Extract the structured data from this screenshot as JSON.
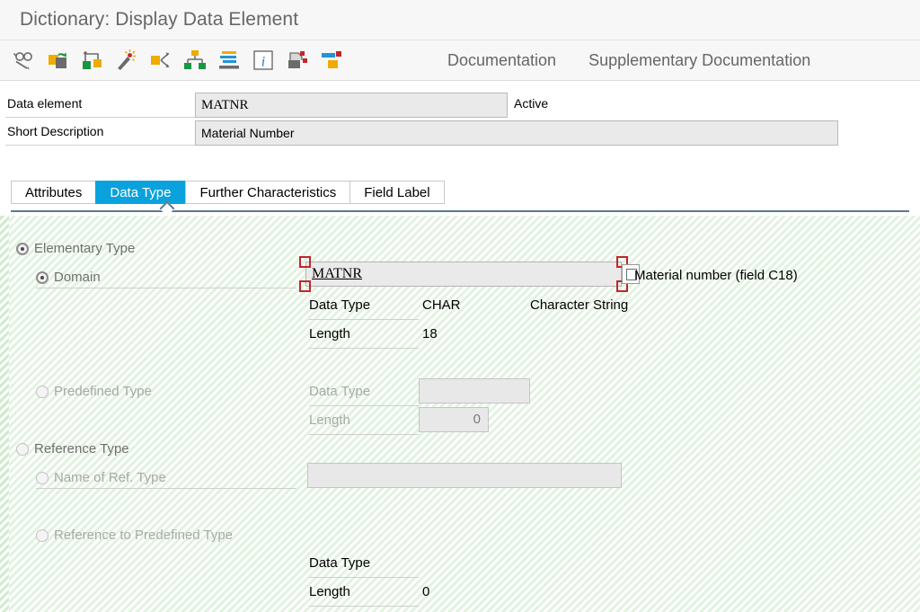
{
  "window": {
    "title": "Dictionary: Display Data Element"
  },
  "toolbar": {
    "icons": [
      {
        "name": "display-glasses-pencil-icon",
        "title": "Display <-> Change"
      },
      {
        "name": "other-object-icon",
        "title": "Other object"
      },
      {
        "name": "copy-object-icon",
        "title": "Copy"
      },
      {
        "name": "magic-wand-icon",
        "title": "Generate"
      },
      {
        "name": "where-used-list-icon",
        "title": "Where-Used List"
      },
      {
        "name": "hierarchy-icon",
        "title": "Hierarchy"
      },
      {
        "name": "active-inactive-icon",
        "title": "Active/Inactive"
      },
      {
        "name": "info-icon",
        "title": "Information"
      },
      {
        "name": "print-preview-icon",
        "title": "Print"
      },
      {
        "name": "technical-settings-icon",
        "title": "Technical settings"
      }
    ],
    "links": [
      {
        "name": "documentation-link",
        "label": "Documentation"
      },
      {
        "name": "supplementary-documentation-link",
        "label": "Supplementary Documentation"
      }
    ]
  },
  "header": {
    "data_element_label": "Data element",
    "data_element_value": "MATNR",
    "status": "Active",
    "short_description_label": "Short Description",
    "short_description_value": "Material Number"
  },
  "tabs": [
    {
      "label": "Attributes",
      "active": false
    },
    {
      "label": "Data Type",
      "active": true
    },
    {
      "label": "Further Characteristics",
      "active": false
    },
    {
      "label": "Field Label",
      "active": false
    }
  ],
  "data_type_tab": {
    "elementary_type": {
      "label": "Elementary Type",
      "selected": true,
      "domain": {
        "label": "Domain",
        "selected": true,
        "value": "MATNR",
        "description": "Material number (field C18)",
        "data_type_label": "Data Type",
        "data_type_value": "CHAR",
        "data_type_text": "Character String",
        "length_label": "Length",
        "length_value": "18"
      },
      "predefined": {
        "label": "Predefined Type",
        "selected": false,
        "data_type_label": "Data Type",
        "data_type_value": "",
        "length_label": "Length",
        "length_value": "0"
      }
    },
    "reference_type": {
      "label": "Reference Type",
      "selected": false,
      "name_of_ref_type": {
        "label": "Name of Ref. Type",
        "selected": false,
        "value": ""
      },
      "reference_to_predefined": {
        "label": "Reference to Predefined Type",
        "selected": false,
        "data_type_label": "Data Type",
        "data_type_value": "",
        "length_label": "Length",
        "length_value": "0"
      }
    }
  },
  "colors": {
    "accent_blue": "#0aa2dc",
    "tab_underline": "#5a7894",
    "focus_red": "#c0272d",
    "panel_green": "#f3faf2",
    "icon_orange": "#f0ab00",
    "icon_green": "#1a9641",
    "icon_gray": "#6b6b6b"
  }
}
